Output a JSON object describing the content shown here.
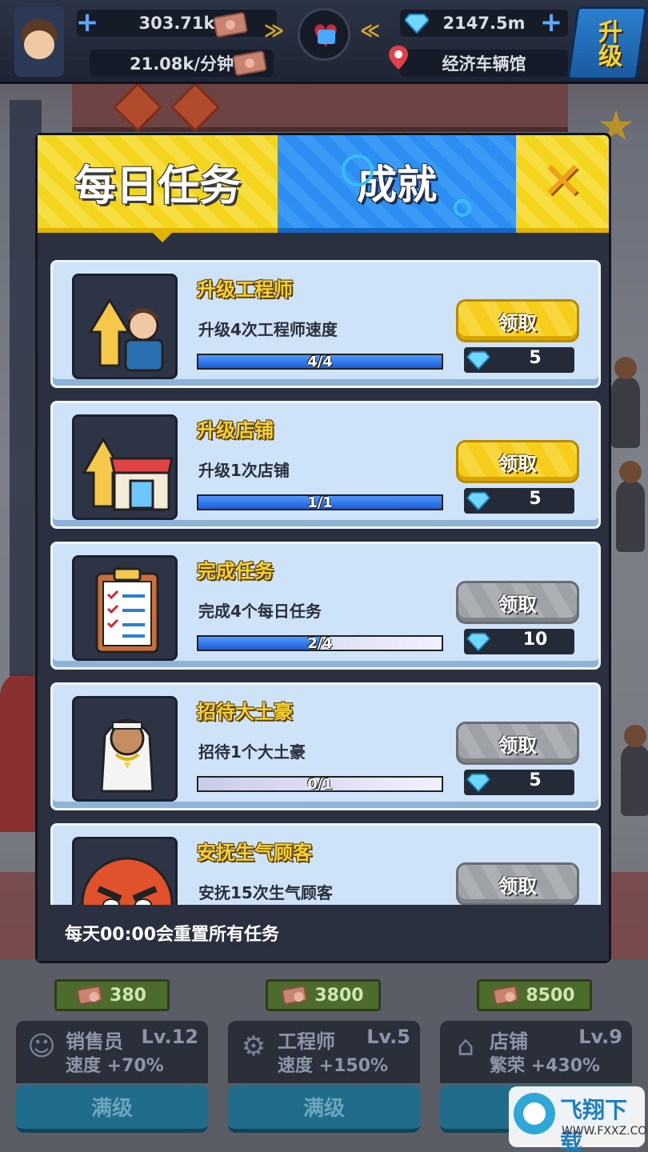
{
  "hud": {
    "cash": "303.71k",
    "rate": "21.08k/分钟",
    "gems": "2147.5m",
    "location": "经济车辆馆",
    "upgrade_label": "升级"
  },
  "modal": {
    "tab_daily": "每日任务",
    "tab_achievements": "成就",
    "close_symbol": "✕",
    "footer_note": "每天00:00会重置所有任务",
    "tasks": [
      {
        "title": "升级工程师",
        "desc": "升级4次工程师速度",
        "progress_text": "4/4",
        "progress": 1.0,
        "claim_label": "领取",
        "claim_enabled": true,
        "reward": "5",
        "icon": "engineer-upgrade-icon"
      },
      {
        "title": "升级店铺",
        "desc": "升级1次店铺",
        "progress_text": "1/1",
        "progress": 1.0,
        "claim_label": "领取",
        "claim_enabled": true,
        "reward": "5",
        "icon": "shop-upgrade-icon"
      },
      {
        "title": "完成任务",
        "desc": "完成4个每日任务",
        "progress_text": "2/4",
        "progress": 0.5,
        "claim_label": "领取",
        "claim_enabled": false,
        "reward": "10",
        "icon": "clipboard-checklist-icon"
      },
      {
        "title": "招待大土豪",
        "desc": "招待1个大土豪",
        "progress_text": "0/1",
        "progress": 0.0,
        "claim_label": "领取",
        "claim_enabled": false,
        "reward": "5",
        "icon": "rich-sheikh-icon"
      },
      {
        "title": "安抚生气顾客",
        "desc": "安抚15次生气顾客",
        "claim_label": "领取",
        "claim_enabled": false,
        "icon": "angry-face-icon"
      }
    ]
  },
  "bottom": {
    "prices": [
      "380",
      "3800",
      "8500"
    ],
    "panels": [
      {
        "name": "销售员",
        "level": "Lv.12",
        "sub": "速度 +70%",
        "button": "满级",
        "icon": "salesperson-icon"
      },
      {
        "name": "工程师",
        "level": "Lv.5",
        "sub": "速度 +150%",
        "button": "满级",
        "icon": "wrench-gear-icon"
      },
      {
        "name": "店铺",
        "level": "Lv.9",
        "sub": "繁荣 +430%",
        "button": "满级",
        "icon": "storefront-icon"
      }
    ]
  },
  "watermark": {
    "brand": "飞翔下载",
    "url": "WWW.FXXZ.COM"
  },
  "colors": {
    "accent_yellow": "#f4d51e",
    "accent_blue": "#2b8ef0",
    "card_bg": "#cfe3f8",
    "panel_dark": "#2a3040"
  }
}
